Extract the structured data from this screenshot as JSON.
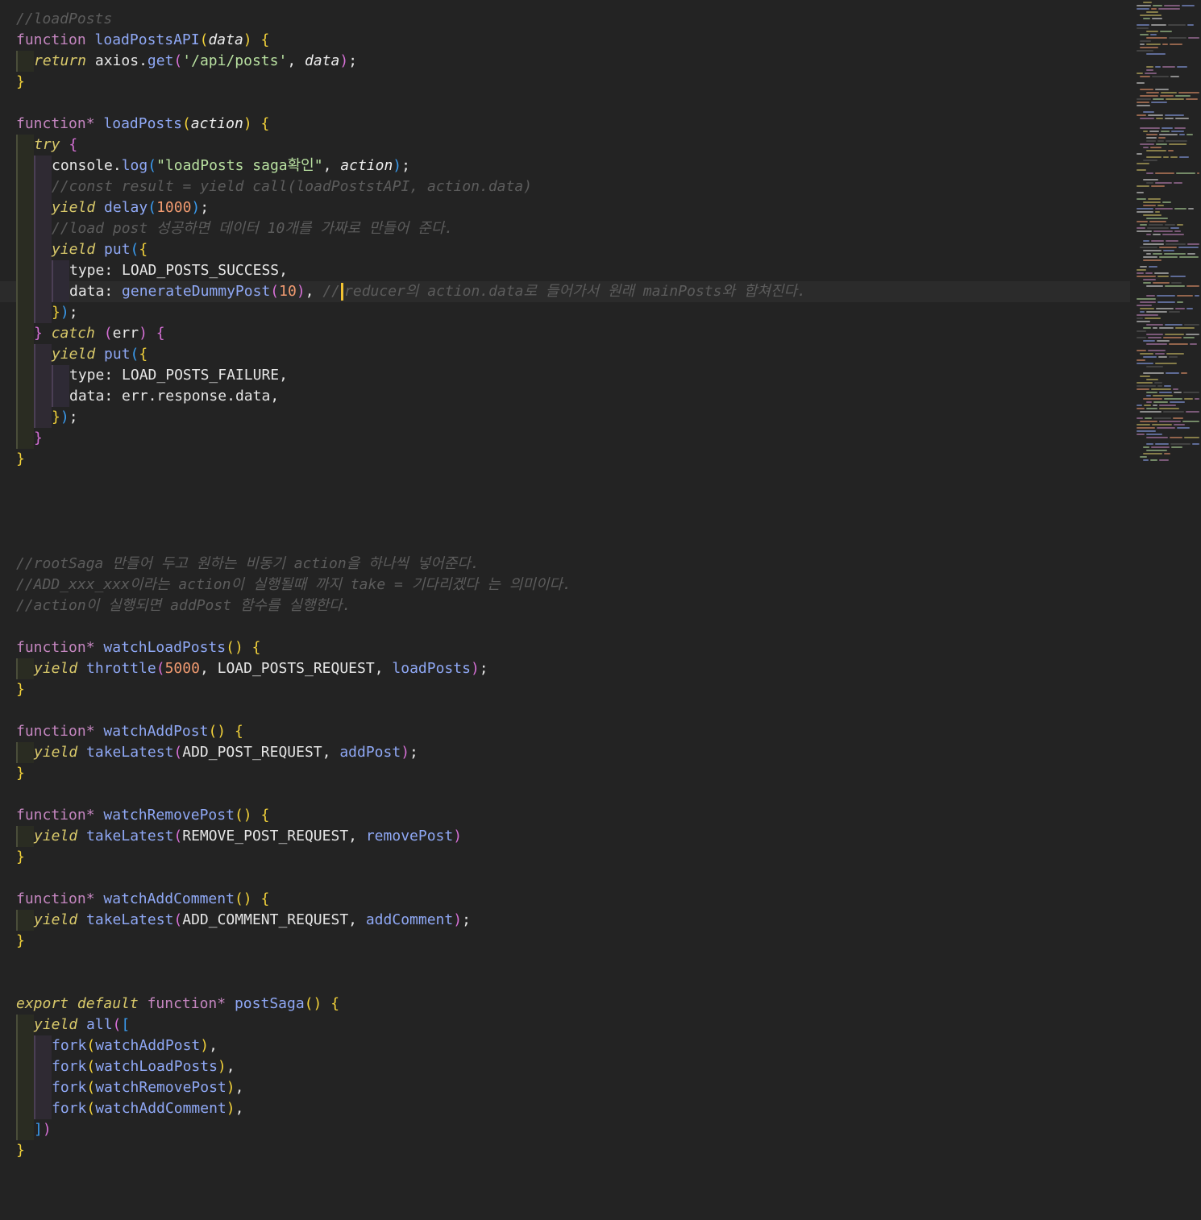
{
  "editor": {
    "theme": {
      "background": "#232323",
      "cursor": "#f1c232"
    },
    "lines": [
      {
        "indent": 0,
        "tokens": [
          [
            "c",
            "//loadPosts"
          ]
        ]
      },
      {
        "indent": 0,
        "tokens": [
          [
            "kw",
            "function"
          ],
          [
            "p",
            " "
          ],
          [
            "fn",
            "loadPostsAPI"
          ],
          [
            "br",
            "("
          ],
          [
            "param",
            "data"
          ],
          [
            "br",
            ")"
          ],
          [
            "p",
            " "
          ],
          [
            "br",
            "{"
          ]
        ]
      },
      {
        "indent": 1,
        "tokens": [
          [
            "ctl",
            "return"
          ],
          [
            "p",
            " axios"
          ],
          [
            "pu",
            "."
          ],
          [
            "fn",
            "get"
          ],
          [
            "br2",
            "("
          ],
          [
            "s",
            "'/api/posts'"
          ],
          [
            "pu",
            ", "
          ],
          [
            "param",
            "data"
          ],
          [
            "br2",
            ")"
          ],
          [
            "pu",
            ";"
          ]
        ]
      },
      {
        "indent": 0,
        "tokens": [
          [
            "br",
            "}"
          ]
        ]
      },
      {
        "indent": 0,
        "tokens": []
      },
      {
        "indent": 0,
        "tokens": [
          [
            "kw",
            "function"
          ],
          [
            "op",
            "*"
          ],
          [
            "p",
            " "
          ],
          [
            "fn",
            "loadPosts"
          ],
          [
            "br",
            "("
          ],
          [
            "param",
            "action"
          ],
          [
            "br",
            ")"
          ],
          [
            "p",
            " "
          ],
          [
            "br",
            "{"
          ]
        ]
      },
      {
        "indent": 1,
        "tokens": [
          [
            "ctl",
            "try"
          ],
          [
            "p",
            " "
          ],
          [
            "br2",
            "{"
          ]
        ]
      },
      {
        "indent": 2,
        "tokens": [
          [
            "p",
            "console"
          ],
          [
            "pu",
            "."
          ],
          [
            "fn",
            "log"
          ],
          [
            "br3",
            "("
          ],
          [
            "s",
            "\"loadPosts saga확인\""
          ],
          [
            "pu",
            ", "
          ],
          [
            "param",
            "action"
          ],
          [
            "br3",
            ")"
          ],
          [
            "pu",
            ";"
          ]
        ]
      },
      {
        "indent": 2,
        "tokens": [
          [
            "c",
            "//const result = yield call(loadPoststAPI, action.data)"
          ]
        ]
      },
      {
        "indent": 2,
        "tokens": [
          [
            "ctl",
            "yield"
          ],
          [
            "p",
            " "
          ],
          [
            "fn",
            "delay"
          ],
          [
            "br3",
            "("
          ],
          [
            "n",
            "1000"
          ],
          [
            "br3",
            ")"
          ],
          [
            "pu",
            ";"
          ]
        ]
      },
      {
        "indent": 2,
        "tokens": [
          [
            "c",
            "//load post 성공하면 데이터 10개를 가짜로 만들어 준다."
          ]
        ]
      },
      {
        "indent": 2,
        "tokens": [
          [
            "ctl",
            "yield"
          ],
          [
            "p",
            " "
          ],
          [
            "fn",
            "put"
          ],
          [
            "br3",
            "("
          ],
          [
            "br",
            "{"
          ]
        ]
      },
      {
        "indent": 3,
        "tokens": [
          [
            "p",
            "type"
          ],
          [
            "pu",
            ": "
          ],
          [
            "p",
            "LOAD_POSTS_SUCCESS"
          ],
          [
            "pu",
            ","
          ]
        ]
      },
      {
        "indent": 3,
        "current": true,
        "tokens": [
          [
            "p",
            "data"
          ],
          [
            "pu",
            ": "
          ],
          [
            "fn",
            "generateDummyPost"
          ],
          [
            "br2",
            "("
          ],
          [
            "n",
            "10"
          ],
          [
            "br2",
            ")"
          ],
          [
            "pu",
            ", "
          ],
          [
            "c",
            "//"
          ],
          [
            "cursor",
            ""
          ],
          [
            "c",
            "reducer의 action.data로 들어가서 원래 mainPosts와 합쳐진다."
          ]
        ]
      },
      {
        "indent": 2,
        "tokens": [
          [
            "br",
            "}"
          ],
          [
            "br3",
            ")"
          ],
          [
            "pu",
            ";"
          ]
        ]
      },
      {
        "indent": 1,
        "tokens": [
          [
            "br2",
            "}"
          ],
          [
            "p",
            " "
          ],
          [
            "ctl",
            "catch"
          ],
          [
            "p",
            " "
          ],
          [
            "br2",
            "("
          ],
          [
            "p",
            "err"
          ],
          [
            "br2",
            ")"
          ],
          [
            "p",
            " "
          ],
          [
            "br2",
            "{"
          ]
        ]
      },
      {
        "indent": 2,
        "tokens": [
          [
            "ctl",
            "yield"
          ],
          [
            "p",
            " "
          ],
          [
            "fn",
            "put"
          ],
          [
            "br3",
            "("
          ],
          [
            "br",
            "{"
          ]
        ]
      },
      {
        "indent": 3,
        "tokens": [
          [
            "p",
            "type"
          ],
          [
            "pu",
            ": "
          ],
          [
            "p",
            "LOAD_POSTS_FAILURE"
          ],
          [
            "pu",
            ","
          ]
        ]
      },
      {
        "indent": 3,
        "tokens": [
          [
            "p",
            "data"
          ],
          [
            "pu",
            ": "
          ],
          [
            "p",
            "err"
          ],
          [
            "pu",
            "."
          ],
          [
            "p",
            "response"
          ],
          [
            "pu",
            "."
          ],
          [
            "p",
            "data"
          ],
          [
            "pu",
            ","
          ]
        ]
      },
      {
        "indent": 2,
        "tokens": [
          [
            "br",
            "}"
          ],
          [
            "br3",
            ")"
          ],
          [
            "pu",
            ";"
          ]
        ]
      },
      {
        "indent": 1,
        "tokens": [
          [
            "br2",
            "}"
          ]
        ]
      },
      {
        "indent": 0,
        "tokens": [
          [
            "br",
            "}"
          ]
        ]
      },
      {
        "indent": 0,
        "tokens": []
      },
      {
        "indent": 0,
        "tokens": []
      },
      {
        "indent": 0,
        "tokens": []
      },
      {
        "indent": 0,
        "tokens": []
      },
      {
        "indent": 0,
        "tokens": [
          [
            "c",
            "//rootSaga 만들어 두고 원하는 비동기 action을 하나씩 넣어준다."
          ]
        ]
      },
      {
        "indent": 0,
        "tokens": [
          [
            "c",
            "//ADD_xxx_xxx이라는 action이 실행될때 까지 take = 기다리겠다 는 의미이다."
          ]
        ]
      },
      {
        "indent": 0,
        "tokens": [
          [
            "c",
            "//action이 실행되면 addPost 함수를 실행한다."
          ]
        ]
      },
      {
        "indent": 0,
        "tokens": []
      },
      {
        "indent": 0,
        "tokens": [
          [
            "kw",
            "function"
          ],
          [
            "op",
            "*"
          ],
          [
            "p",
            " "
          ],
          [
            "fn",
            "watchLoadPosts"
          ],
          [
            "br",
            "()"
          ],
          [
            "p",
            " "
          ],
          [
            "br",
            "{"
          ]
        ]
      },
      {
        "indent": 1,
        "tokens": [
          [
            "ctl",
            "yield"
          ],
          [
            "p",
            " "
          ],
          [
            "fn",
            "throttle"
          ],
          [
            "br2",
            "("
          ],
          [
            "n",
            "5000"
          ],
          [
            "pu",
            ", "
          ],
          [
            "p",
            "LOAD_POSTS_REQUEST"
          ],
          [
            "pu",
            ", "
          ],
          [
            "fn",
            "loadPosts"
          ],
          [
            "br2",
            ")"
          ],
          [
            "pu",
            ";"
          ]
        ]
      },
      {
        "indent": 0,
        "tokens": [
          [
            "br",
            "}"
          ]
        ]
      },
      {
        "indent": 0,
        "tokens": []
      },
      {
        "indent": 0,
        "tokens": [
          [
            "kw",
            "function"
          ],
          [
            "op",
            "*"
          ],
          [
            "p",
            " "
          ],
          [
            "fn",
            "watchAddPost"
          ],
          [
            "br",
            "()"
          ],
          [
            "p",
            " "
          ],
          [
            "br",
            "{"
          ]
        ]
      },
      {
        "indent": 1,
        "tokens": [
          [
            "ctl",
            "yield"
          ],
          [
            "p",
            " "
          ],
          [
            "fn",
            "takeLatest"
          ],
          [
            "br2",
            "("
          ],
          [
            "p",
            "ADD_POST_REQUEST"
          ],
          [
            "pu",
            ", "
          ],
          [
            "fn",
            "addPost"
          ],
          [
            "br2",
            ")"
          ],
          [
            "pu",
            ";"
          ]
        ]
      },
      {
        "indent": 0,
        "tokens": [
          [
            "br",
            "}"
          ]
        ]
      },
      {
        "indent": 0,
        "tokens": []
      },
      {
        "indent": 0,
        "tokens": [
          [
            "kw",
            "function"
          ],
          [
            "op",
            "*"
          ],
          [
            "p",
            " "
          ],
          [
            "fn",
            "watchRemovePost"
          ],
          [
            "br",
            "()"
          ],
          [
            "p",
            " "
          ],
          [
            "br",
            "{"
          ]
        ]
      },
      {
        "indent": 1,
        "tokens": [
          [
            "ctl",
            "yield"
          ],
          [
            "p",
            " "
          ],
          [
            "fn",
            "takeLatest"
          ],
          [
            "br2",
            "("
          ],
          [
            "p",
            "REMOVE_POST_REQUEST"
          ],
          [
            "pu",
            ", "
          ],
          [
            "fn",
            "removePost"
          ],
          [
            "br2",
            ")"
          ]
        ]
      },
      {
        "indent": 0,
        "tokens": [
          [
            "br",
            "}"
          ]
        ]
      },
      {
        "indent": 0,
        "tokens": []
      },
      {
        "indent": 0,
        "tokens": [
          [
            "kw",
            "function"
          ],
          [
            "op",
            "*"
          ],
          [
            "p",
            " "
          ],
          [
            "fn",
            "watchAddComment"
          ],
          [
            "br",
            "()"
          ],
          [
            "p",
            " "
          ],
          [
            "br",
            "{"
          ]
        ]
      },
      {
        "indent": 1,
        "tokens": [
          [
            "ctl",
            "yield"
          ],
          [
            "p",
            " "
          ],
          [
            "fn",
            "takeLatest"
          ],
          [
            "br2",
            "("
          ],
          [
            "p",
            "ADD_COMMENT_REQUEST"
          ],
          [
            "pu",
            ", "
          ],
          [
            "fn",
            "addComment"
          ],
          [
            "br2",
            ")"
          ],
          [
            "pu",
            ";"
          ]
        ]
      },
      {
        "indent": 0,
        "tokens": [
          [
            "br",
            "}"
          ]
        ]
      },
      {
        "indent": 0,
        "tokens": []
      },
      {
        "indent": 0,
        "tokens": []
      },
      {
        "indent": 0,
        "tokens": [
          [
            "ctl",
            "export"
          ],
          [
            "p",
            " "
          ],
          [
            "ctl",
            "default"
          ],
          [
            "p",
            " "
          ],
          [
            "kw",
            "function"
          ],
          [
            "op",
            "*"
          ],
          [
            "p",
            " "
          ],
          [
            "fn",
            "postSaga"
          ],
          [
            "br",
            "()"
          ],
          [
            "p",
            " "
          ],
          [
            "br",
            "{"
          ]
        ]
      },
      {
        "indent": 1,
        "tokens": [
          [
            "ctl",
            "yield"
          ],
          [
            "p",
            " "
          ],
          [
            "fn",
            "all"
          ],
          [
            "br2",
            "("
          ],
          [
            "br3",
            "["
          ]
        ]
      },
      {
        "indent": 2,
        "tokens": [
          [
            "fn",
            "fork"
          ],
          [
            "br",
            "("
          ],
          [
            "fn",
            "watchAddPost"
          ],
          [
            "br",
            ")"
          ],
          [
            "pu",
            ","
          ]
        ]
      },
      {
        "indent": 2,
        "tokens": [
          [
            "fn",
            "fork"
          ],
          [
            "br",
            "("
          ],
          [
            "fn",
            "watchLoadPosts"
          ],
          [
            "br",
            ")"
          ],
          [
            "pu",
            ","
          ]
        ]
      },
      {
        "indent": 2,
        "tokens": [
          [
            "fn",
            "fork"
          ],
          [
            "br",
            "("
          ],
          [
            "fn",
            "watchRemovePost"
          ],
          [
            "br",
            ")"
          ],
          [
            "pu",
            ","
          ]
        ]
      },
      {
        "indent": 2,
        "tokens": [
          [
            "fn",
            "fork"
          ],
          [
            "br",
            "("
          ],
          [
            "fn",
            "watchAddComment"
          ],
          [
            "br",
            ")"
          ],
          [
            "pu",
            ","
          ]
        ]
      },
      {
        "indent": 1,
        "tokens": [
          [
            "br3",
            "]"
          ],
          [
            "br2",
            ")"
          ]
        ]
      },
      {
        "indent": 0,
        "tokens": [
          [
            "br",
            "}"
          ]
        ]
      }
    ],
    "token_colors": {
      "kw": "#c586c0",
      "fn": "#8fa8f5",
      "param": "#eeeeee",
      "ctl": "#d9c96a",
      "s": "#b8e0a0",
      "n": "#f09a70",
      "c": "#5c5c5c",
      "p": "#e6e6e6",
      "pu": "#e6e6e6",
      "op": "#c586c0",
      "br": "#f3d23a",
      "br2": "#d670d6",
      "br3": "#3a9cf0"
    },
    "italic_types": [
      "param",
      "ctl",
      "c"
    ]
  }
}
